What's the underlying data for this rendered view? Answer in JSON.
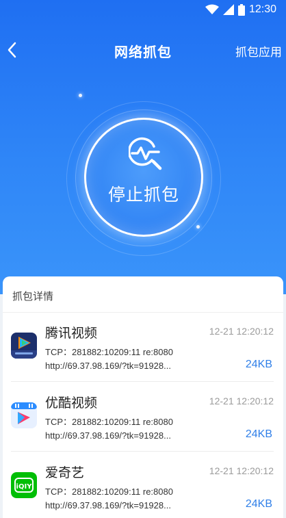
{
  "status_bar": {
    "time": "12:30"
  },
  "nav": {
    "title": "网络抓包",
    "action_label": "抓包应用"
  },
  "capture_button": {
    "label": "停止抓包"
  },
  "details": {
    "title": "抓包详情",
    "items": [
      {
        "app": "腾讯视频",
        "time": "12-21 12:20:12",
        "tcp": "TCP：281882:10209:11  re:8080",
        "url": "http://69.37.98.169/?tk=91928...",
        "size": "24KB",
        "icon": "tencent-video-icon"
      },
      {
        "app": "优酷视频",
        "time": "12-21 12:20:12",
        "tcp": "TCP：281882:10209:11  re:8080",
        "url": "http://69.37.98.169/?tk=91928...",
        "size": "24KB",
        "icon": "youku-icon"
      },
      {
        "app": "爱奇艺",
        "time": "12-21 12:20:12",
        "tcp": "TCP：281882:10209:11  re:8080",
        "url": "http://69.37.98.169/?tk=91928...",
        "size": "24KB",
        "icon": "iqiyi-icon"
      }
    ]
  },
  "colors": {
    "header_blue": "#1f6ff2",
    "size_blue": "#2f7fe8",
    "iqiyi_green": "#00be06"
  }
}
